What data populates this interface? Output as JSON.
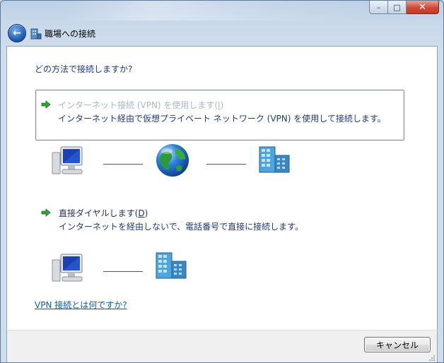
{
  "window": {
    "title": "職場への接続",
    "buttons": {
      "minimize": "–",
      "maximize": "□",
      "close": "✕"
    }
  },
  "question": "どの方法で接続しますか?",
  "options": [
    {
      "title": "インターネット接続 (VPN) を使用します(",
      "shortcut": "I",
      "title_end": ")",
      "description": "インターネット経由で仮想プライベート ネットワーク (VPN) を使用して接続します。",
      "state": "highlighted-disabled"
    },
    {
      "title": "直接ダイヤルします(",
      "shortcut": "D",
      "title_end": ")",
      "description": "インターネットを経由しないで、電話番号で直接に接続します。"
    }
  ],
  "help_link": "VPN 接続とは何ですか?",
  "footer": {
    "cancel_label": "キャンセル"
  },
  "icons": {
    "back": "back-arrow-icon",
    "network": "network-building-icon",
    "option_arrow": "green-arrow-icon",
    "computer": "computer-monitor-icon",
    "internet": "globe-icon",
    "workplace": "office-building-icon"
  },
  "colors": {
    "accent_link": "#0b5cad",
    "title_text": "#1e3a8a",
    "disabled_text": "#a6b6cd"
  }
}
